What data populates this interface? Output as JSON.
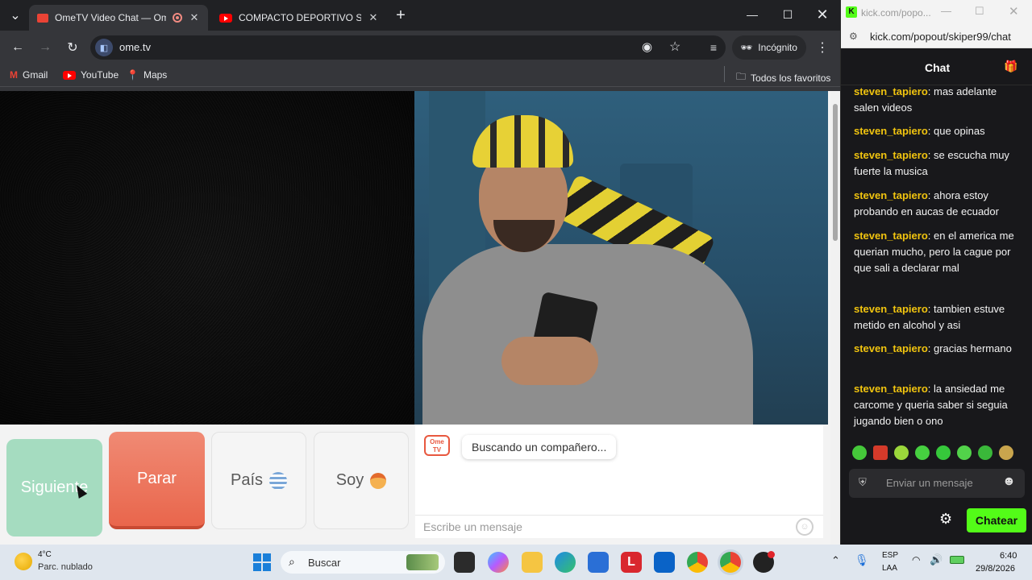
{
  "tabs": [
    {
      "title": "OmeTV Video Chat — Ome",
      "active": true
    },
    {
      "title": "COMPACTO DEPORTIVO STIVEN",
      "active": false
    }
  ],
  "toolbar": {
    "url": "ome.tv",
    "incognito_label": "Incógnito"
  },
  "bookmarks": [
    {
      "label": "Gmail",
      "icon": "gmail-icon"
    },
    {
      "label": "YouTube",
      "icon": "youtube-icon"
    },
    {
      "label": "Maps",
      "icon": "maps-icon"
    }
  ],
  "bookmarks_all": "Todos los favoritos",
  "controls": {
    "next": "Siguiente",
    "stop": "Parar",
    "country": "País",
    "country_flag": "uruguay-flag-icon",
    "soy": "Soy",
    "soy_icon": "boy-emoji-icon"
  },
  "chat": {
    "logo": "Ome TV",
    "status": "Buscando un compañero...",
    "placeholder": "Escribe un mensaje"
  },
  "kick": {
    "window_title": "kick.com/popo...",
    "url": "kick.com/popout/skiper99/chat",
    "header": "Chat",
    "input_placeholder": "Enviar un mensaje",
    "send_label": "Chatear",
    "messages": [
      {
        "user": "steven_tapiero",
        "text": "mas adelante salen videos"
      },
      {
        "user": "steven_tapiero",
        "text": "que opinas"
      },
      {
        "user": "steven_tapiero",
        "text": "se escucha muy fuerte la musica"
      },
      {
        "user": "steven_tapiero",
        "text": "ahora estoy probando en aucas de ecuador"
      },
      {
        "user": "steven_tapiero",
        "text": "en el america me querian mucho, pero la cague por que sali a declarar mal"
      },
      {
        "user": "steven_tapiero",
        "text": "tambien estuve metido en alcohol y asi"
      },
      {
        "user": "steven_tapiero",
        "text": "gracias hermano"
      },
      {
        "user": "steven_tapiero",
        "text": "la ansiedad me carcome y queria saber si seguia jugando bien o ono"
      }
    ]
  },
  "taskbar": {
    "weather_temp": "4°C",
    "weather_desc": "Parc. nublado",
    "search": "Buscar",
    "lang1": "ESP",
    "lang2": "LAA",
    "time": "6:40",
    "date": "29/8/2026"
  }
}
